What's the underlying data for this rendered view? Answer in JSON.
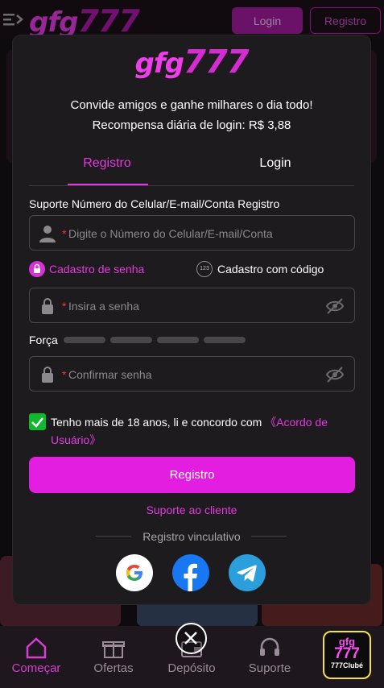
{
  "app": {
    "logo_text": "gfg",
    "logo_num": "777",
    "login_label": "Login",
    "register_label": "Registro"
  },
  "modal": {
    "logo_text": "gfg",
    "logo_num": "777",
    "promo_line1": "Convide amigos e ganhe milhares o dia todo!",
    "promo_line2": "Recompensa diária de login: R$ 3,88",
    "tabs": [
      {
        "label": "Registro",
        "active": true
      },
      {
        "label": "Login",
        "active": false
      }
    ],
    "account_label": "Suporte Número do Celular/E-mail/Conta Registro",
    "account_placeholder": "Digite o Número do Celular/E-mail/Conta",
    "required_mark": "*",
    "option_password": "Cadastro de senha",
    "option_code_icon": "123",
    "option_code": "Cadastro com código",
    "password_placeholder": "Insira a senha",
    "strength_label": "Força",
    "confirm_placeholder": "Confirmar senha",
    "agree_text": "Tenho mais de 18 anos, li e concordo com",
    "agree_link": "《Acordo de Usuário》",
    "agree_checked": true,
    "register_button": "Registro",
    "support_link": "Suporte ao cliente",
    "link_label": "Registro vinculativo",
    "social": [
      "google-icon",
      "facebook-icon",
      "telegram-icon"
    ]
  },
  "bottom_nav": {
    "items": [
      {
        "label": "Começar",
        "icon": "home-icon",
        "active": true
      },
      {
        "label": "Ofertas",
        "icon": "gift-icon",
        "active": false
      },
      {
        "label": "Depósito",
        "icon": "wallet-icon",
        "active": false
      },
      {
        "label": "Suporte",
        "icon": "headset-icon",
        "active": false
      }
    ],
    "club_top": "gfg",
    "club_mid": "777",
    "club_bottom": "777Clubé"
  },
  "colors": {
    "accent": "#e41ee0",
    "modal_bg": "#1d1b1e",
    "check": "#11b82e"
  }
}
